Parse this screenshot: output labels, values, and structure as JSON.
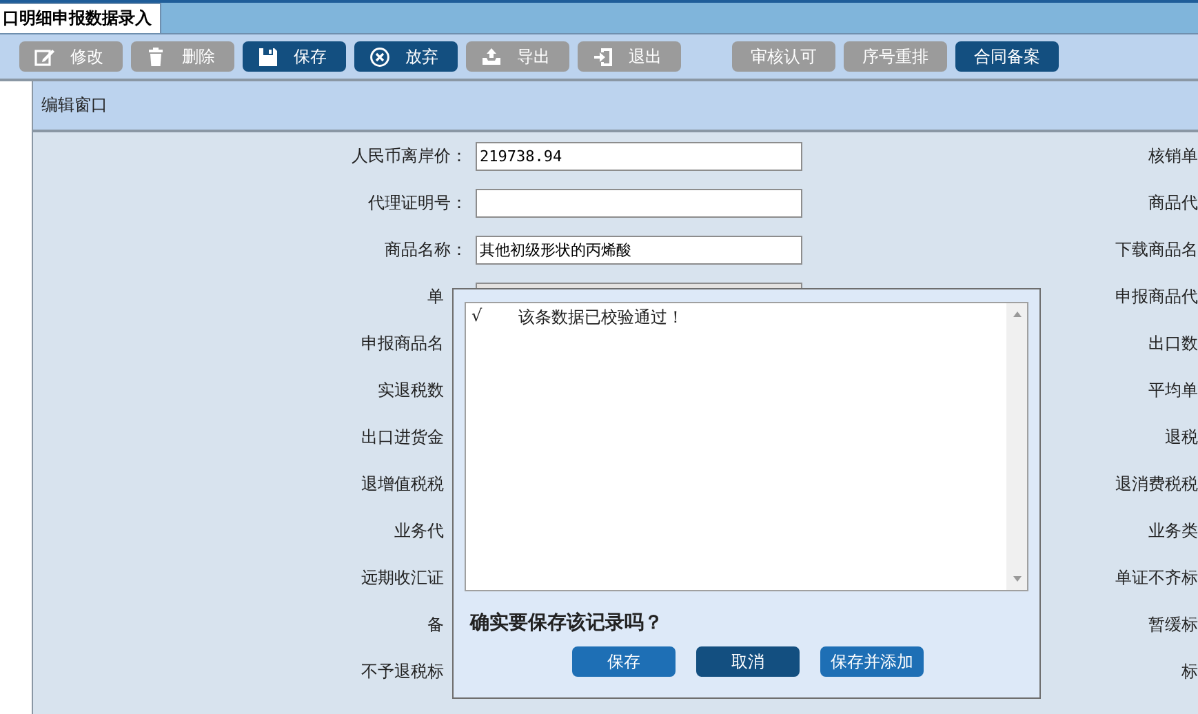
{
  "tab": {
    "label": "口明细申报数据录入",
    "selected": true
  },
  "toolbar": [
    {
      "label": "修改",
      "disabled": true
    },
    {
      "label": "删除",
      "disabled": true
    },
    {
      "label": "保存",
      "disabled": false
    },
    {
      "label": "放弃",
      "disabled": false
    },
    {
      "label": "导出",
      "disabled": true
    },
    {
      "label": "退出",
      "disabled": true
    },
    {
      "label": "审核认可",
      "disabled": true
    },
    {
      "label": "序号重排",
      "disabled": true
    },
    {
      "label": "合同备案",
      "disabled": false
    }
  ],
  "panel": {
    "title": "编辑窗口"
  },
  "form_left": [
    {
      "kind": "field",
      "label": "人民币离岸价：",
      "value": "219738.94",
      "disabled": false
    },
    {
      "kind": "field",
      "label": "代理证明号：",
      "disabled": false
    },
    {
      "kind": "field",
      "label": "商品名称：",
      "value": "其他初级形状的丙烯酸",
      "disabled": false
    },
    {
      "kind": "covered",
      "label": "单",
      "disabled": true
    },
    {
      "kind": "covered",
      "label": "申报商品名"
    },
    {
      "kind": "covered",
      "label": "实退税数"
    },
    {
      "kind": "covered",
      "label": "出口进货金"
    },
    {
      "kind": "covered",
      "label": "退增值税税"
    },
    {
      "kind": "covered",
      "label": "业务代"
    },
    {
      "kind": "covered",
      "label": "远期收汇证"
    },
    {
      "kind": "covered",
      "label": "备"
    },
    {
      "kind": "covered",
      "label": "不予退税标"
    }
  ],
  "form_right": [
    "核销单",
    "商品代",
    "下载商品名",
    "申报商品代",
    "出口数",
    "平均单",
    "退税",
    "退消费税税",
    "业务类",
    "单证不齐标",
    "暂缓标",
    "标"
  ],
  "dialog": {
    "messages": [
      {
        "mark": "√",
        "text": "该条数据已校验通过！"
      }
    ],
    "question": "确实要保存该记录吗？",
    "buttons": [
      {
        "label": "保存",
        "focused": false
      },
      {
        "label": "取消",
        "focused": true
      },
      {
        "label": "保存并添加",
        "focused": false
      }
    ]
  }
}
